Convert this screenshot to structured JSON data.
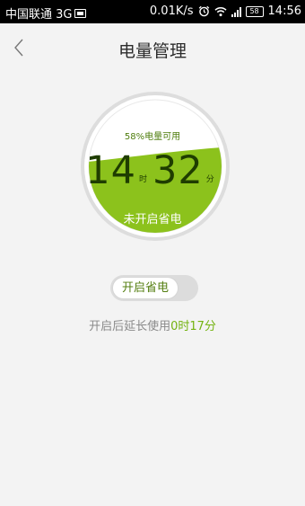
{
  "status_bar": {
    "carrier": "中国联通 3G",
    "net_speed": "0.01K/s",
    "battery": "58",
    "time": "14:56"
  },
  "header": {
    "title": "电量管理",
    "back_icon": "chevron-left-icon"
  },
  "gauge": {
    "percent_text": "58%电量可用",
    "hours": "14",
    "hours_unit": "时",
    "minutes": "32",
    "minutes_unit": "分",
    "status": "未开启省电",
    "fill_level": 0.58,
    "fill_color": "#8cc21c"
  },
  "toggle": {
    "label": "开启省电",
    "on": false
  },
  "extend": {
    "prefix": "开启后延长使用",
    "value": "0时17分"
  },
  "colors": {
    "accent": "#74b311",
    "background": "#f3f3f3"
  }
}
